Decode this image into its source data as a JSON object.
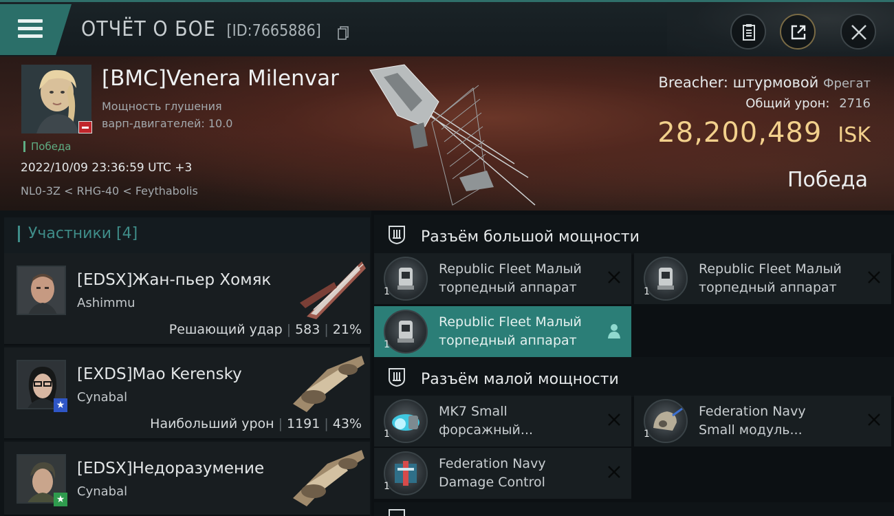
{
  "header": {
    "title": "ОТЧЁТ О БОЕ",
    "report_id": "[ID:7665886]"
  },
  "victim": {
    "name": "[BMC]Venera Milenvar",
    "stat_label_line1": "Мощность глушения",
    "stat_label_line2": "варп-двигателей: 10.0",
    "tag": "Победа",
    "datetime": "2022/10/09 23:36:59 UTC +3",
    "location": "NL0-3Z < RHG-40 < Feythabolis",
    "ship_name": "Breacher: штурмовой",
    "ship_class": "Фрегат",
    "damage_label": "Общий урон:",
    "damage_value": "2716",
    "isk_value": "28,200,489",
    "isk_unit": "ISK",
    "result": "Победа"
  },
  "participants": {
    "header": "Участники [4]",
    "items": [
      {
        "name": "[EDSX]Жан-пьер Хомяк",
        "ship": "Ashimmu",
        "stat_label": "Решающий удар",
        "damage": "583",
        "percent": "21%"
      },
      {
        "name": "[EXDS]Mao Kerensky",
        "ship": "Cynabal",
        "stat_label": "Наибольший урон",
        "damage": "1191",
        "percent": "43%"
      },
      {
        "name": "[EDSX]Недоразумение",
        "ship": "Cynabal"
      }
    ]
  },
  "modules": {
    "high_slot_title": "Разъём большой мощности",
    "low_slot_title": "Разъём малой мощности",
    "high": [
      {
        "line1": "Republic Fleet Малый",
        "line2": "торпедный аппарат",
        "qty": "1"
      },
      {
        "line1": "Republic Fleet Малый",
        "line2": "торпедный аппарат",
        "qty": "1"
      },
      {
        "line1": "Republic Fleet Малый",
        "line2": "торпедный аппарат",
        "qty": "1"
      }
    ],
    "low": [
      {
        "line1": "MK7 Small",
        "line2": "форсажный...",
        "qty": "1"
      },
      {
        "line1": "Federation Navy",
        "line2": "Small модуль...",
        "qty": "1"
      },
      {
        "line1": "Federation Navy",
        "line2": "Damage Control",
        "qty": "1"
      }
    ]
  },
  "colors": {
    "accent_teal": "#2b7e77",
    "isk_gold": "#f2d08c",
    "victory_green": "#5fae84",
    "badge_red": "#c0262b"
  }
}
